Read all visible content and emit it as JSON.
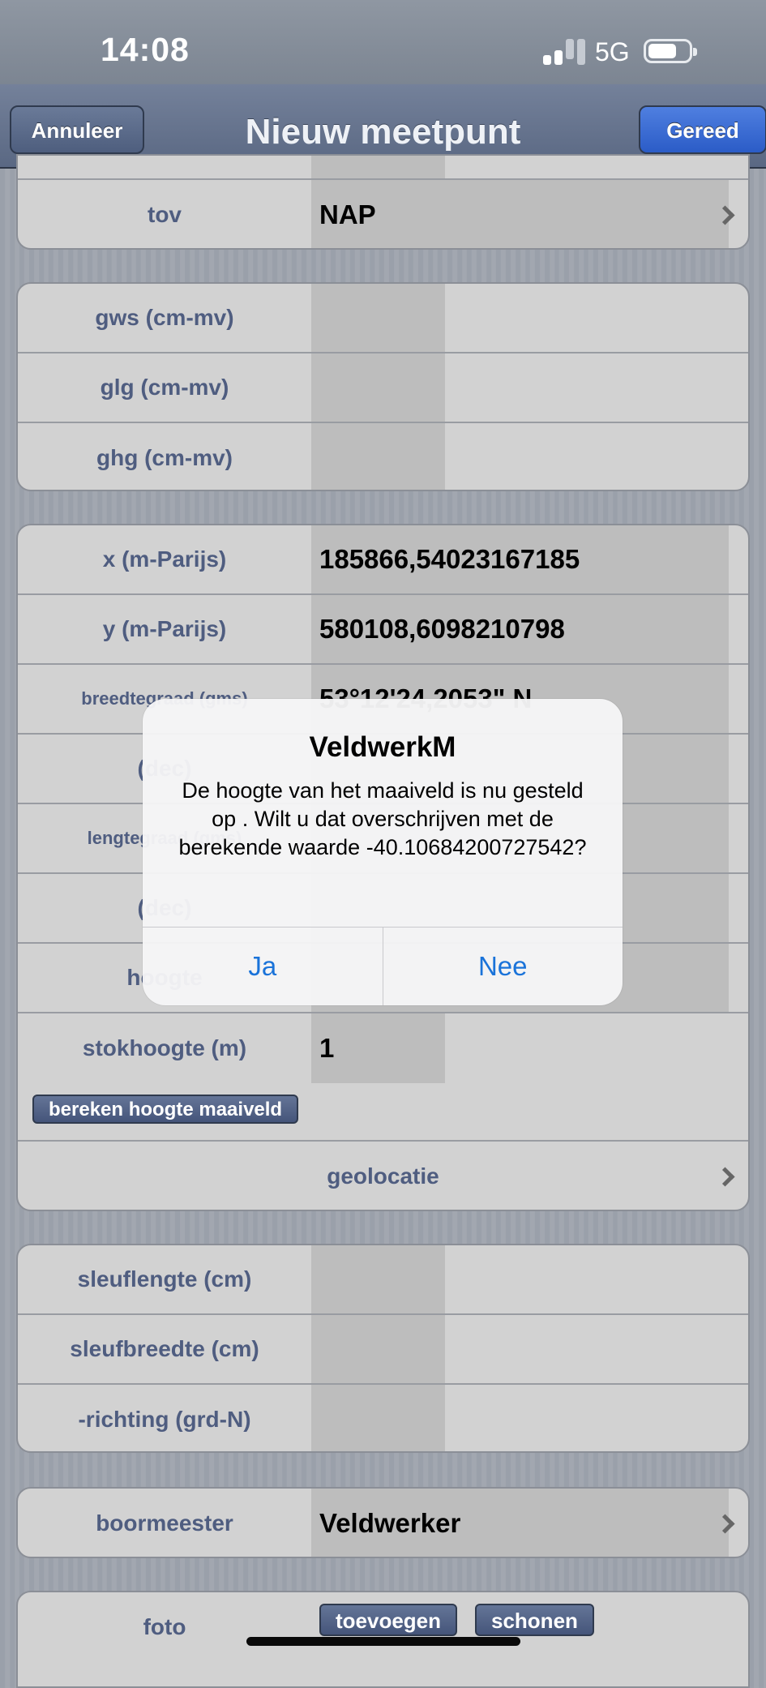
{
  "status_bar": {
    "time": "14:08",
    "network": "5G"
  },
  "nav": {
    "title": "Nieuw meetpunt",
    "cancel_label": "Annuleer",
    "done_label": "Gereed"
  },
  "tov": {
    "label": "tov",
    "value": "NAP"
  },
  "water": {
    "rows": [
      "gws (cm-mv)",
      "glg (cm-mv)",
      "ghg (cm-mv)"
    ]
  },
  "coords": {
    "x_label": "x (m-Parijs)",
    "x_value": "185866,54023167185",
    "y_label": "y (m-Parijs)",
    "y_value": "580108,6098210798",
    "lat_label": "breedtegraad (gms)",
    "lat_value": "53°12'24,2053\" N",
    "lat_dec_label": "(dec)",
    "lon_label": "lengtegraad (gms)",
    "lon_dec_label": "(dec)",
    "height_label": "hoogte",
    "stick_label": "stokhoogte (m)",
    "stick_value": "1",
    "calc_button": "bereken hoogte maaiveld",
    "geolocation": "geolocatie"
  },
  "trench": {
    "rows": [
      "sleuflengte (cm)",
      "sleufbreedte (cm)",
      "-richting (grd-N)"
    ]
  },
  "driller": {
    "label": "boormeester",
    "value": "Veldwerker"
  },
  "photo": {
    "label": "foto",
    "add_button": "toevoegen",
    "clear_button": "schonen"
  },
  "alert": {
    "title": "VeldwerkM",
    "message": "De hoogte van het maaiveld is nu gesteld op . Wilt u dat overschrijven met de berekende waarde -40.10684200727542?",
    "yes": "Ja",
    "no": "Nee"
  }
}
